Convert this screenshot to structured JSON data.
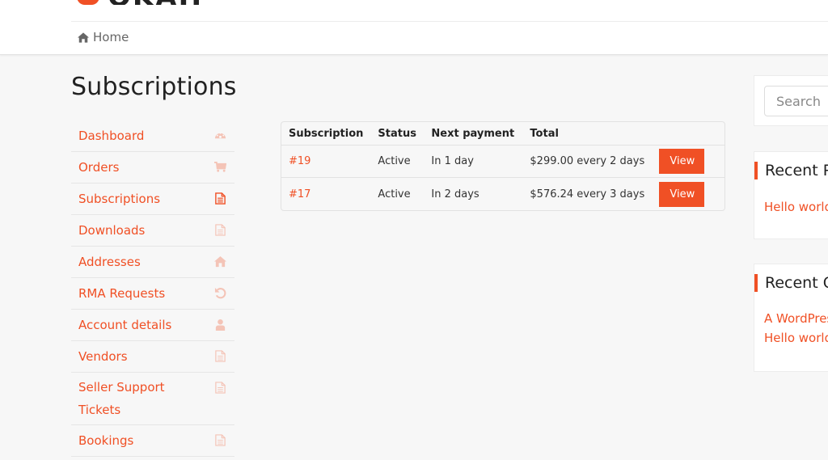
{
  "brand": {
    "logo_text": "OKAH",
    "accent_color": "#f05025"
  },
  "breadcrumb": {
    "icon": "home-icon",
    "label": "Home"
  },
  "page": {
    "title": "Subscriptions"
  },
  "account_nav": {
    "items": [
      {
        "label": "Dashboard",
        "icon": "dashboard-icon",
        "active": false
      },
      {
        "label": "Orders",
        "icon": "cart-icon",
        "active": false
      },
      {
        "label": "Subscriptions",
        "icon": "file-text-icon",
        "active": true
      },
      {
        "label": "Downloads",
        "icon": "file-icon",
        "active": false
      },
      {
        "label": "Addresses",
        "icon": "home-icon",
        "active": false
      },
      {
        "label": "RMA Requests",
        "icon": "undo-icon",
        "active": false
      },
      {
        "label": "Account details",
        "icon": "user-icon",
        "active": false
      },
      {
        "label": "Vendors",
        "icon": "file-icon",
        "active": false
      },
      {
        "label": "Seller Support Tickets",
        "icon": "file-icon",
        "active": false
      },
      {
        "label": "Bookings",
        "icon": "file-icon",
        "active": false
      }
    ]
  },
  "subscriptions_table": {
    "columns": [
      "Subscription",
      "Status",
      "Next payment",
      "Total",
      ""
    ],
    "rows": [
      {
        "id": "#19",
        "status": "Active",
        "next_payment": "In 1 day",
        "total": "$299.00 every 2 days",
        "action": "View"
      },
      {
        "id": "#17",
        "status": "Active",
        "next_payment": "In 2 days",
        "total": "$576.24 every 3 days",
        "action": "View"
      }
    ]
  },
  "sidebar": {
    "search": {
      "placeholder": "Search ..."
    },
    "recent_posts": {
      "title": "Recent Posts",
      "items": [
        "Hello world!"
      ]
    },
    "recent_comments": {
      "title": "Recent Comments",
      "items": [
        "A WordPress Commenter",
        "Hello world!"
      ]
    }
  }
}
